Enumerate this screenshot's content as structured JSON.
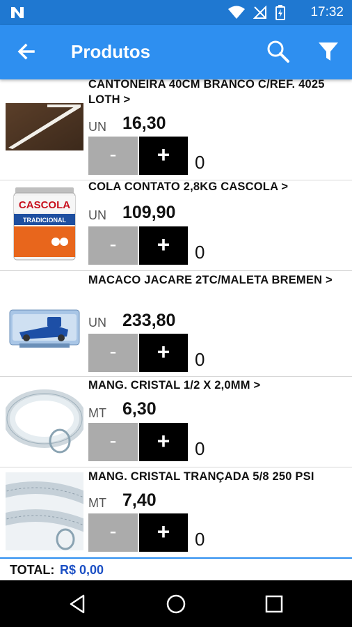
{
  "status": {
    "time": "17:32"
  },
  "appbar": {
    "title": "Produtos"
  },
  "products": [
    {
      "name": "CANTONEIRA 40CM BRANCO C/REF. 4025 LOTH >",
      "unit": "UN",
      "price": "16,30",
      "minus": "-",
      "plus": "+",
      "qty": "0"
    },
    {
      "name": "COLA CONTATO 2,8KG CASCOLA >",
      "unit": "UN",
      "price": "109,90",
      "minus": "-",
      "plus": "+",
      "qty": "0",
      "image_text": {
        "brand": "CASCOLA",
        "label": "TRADICIONAL"
      }
    },
    {
      "name": "MACACO JACARE 2TC/MALETA BREMEN >",
      "unit": "UN",
      "price": "233,80",
      "minus": "-",
      "plus": "+",
      "qty": "0"
    },
    {
      "name": "MANG. CRISTAL 1/2 X 2,0MM >",
      "unit": "MT",
      "price": "6,30",
      "minus": "-",
      "plus": "+",
      "qty": "0"
    },
    {
      "name": "MANG. CRISTAL TRANÇADA 5/8 250 PSI",
      "unit": "MT",
      "price": "7,40",
      "minus": "-",
      "plus": "+",
      "qty": "0"
    }
  ],
  "footer": {
    "total_label": "TOTAL:",
    "total_value": "R$ 0,00"
  },
  "icons": {
    "back": "arrow-left",
    "search": "magnifier",
    "filter": "funnel",
    "nav_back": "triangle-left",
    "nav_home": "circle",
    "nav_recent": "square"
  },
  "colors": {
    "primary": "#2e8ff0",
    "status_bar": "#1f78d1",
    "minus_button": "#ababab",
    "plus_button": "#000000",
    "total_value": "#1b4fc4"
  }
}
